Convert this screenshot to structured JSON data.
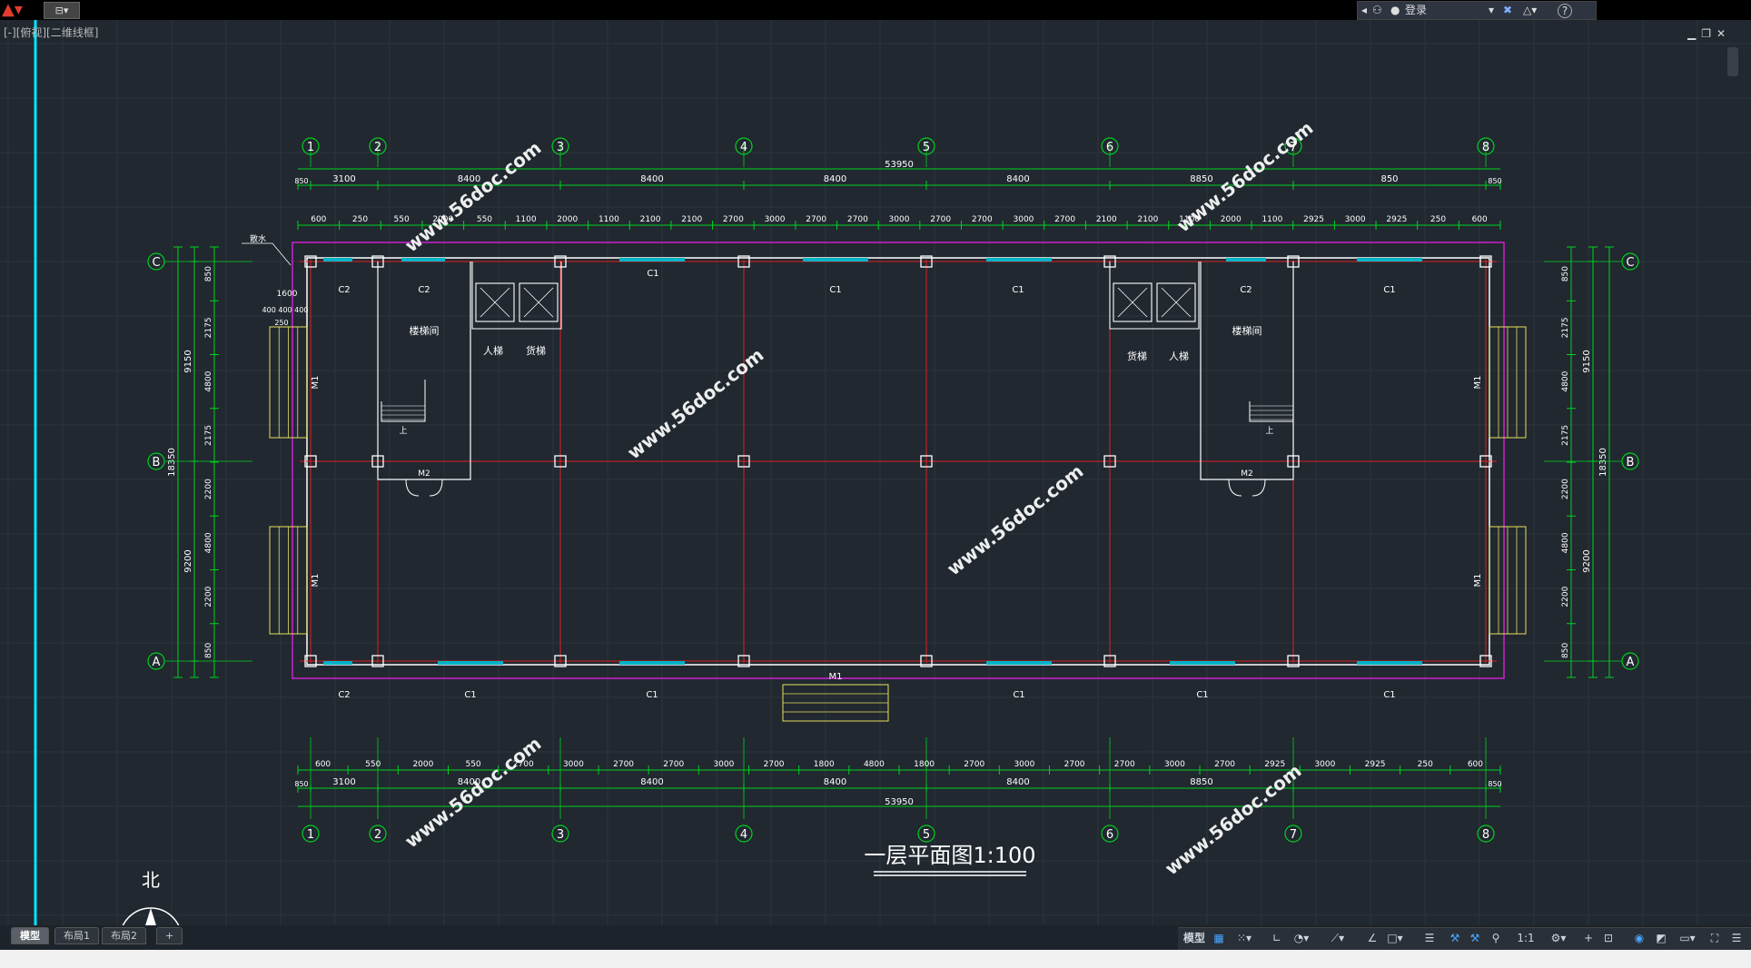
{
  "titlebar": {
    "app_icon": "autocad-a-icon",
    "qat_label": "⊟▾",
    "signin_label": "登录",
    "exchange_icon": "exchange-x-icon",
    "help_label": "?"
  },
  "viewport": {
    "label": "[-][俯视][二维线框]"
  },
  "drawing": {
    "title": "一层平面图1:100",
    "north_label": "北",
    "grid_cols": [
      "1",
      "2",
      "3",
      "4",
      "5",
      "6",
      "7",
      "8"
    ],
    "grid_rows": [
      "C",
      "B",
      "A"
    ],
    "total_length": "53950",
    "top_dims": [
      "850",
      "3100",
      "8400",
      "8400",
      "8400",
      "8400",
      "8850",
      "850"
    ],
    "top_fine_dims": [
      "600",
      "250",
      "550",
      "2000",
      "550",
      "1100",
      "2000",
      "1100",
      "2100",
      "2100",
      "2700",
      "3000",
      "2700",
      "2700",
      "3000",
      "2700",
      "2700",
      "3000",
      "2700",
      "2100",
      "2100",
      "1100",
      "2000",
      "1100",
      "2925",
      "3000",
      "2925",
      "250",
      "600"
    ],
    "bottom_fine_dims": [
      "600",
      "550",
      "2000",
      "550",
      "2700",
      "3000",
      "2700",
      "2700",
      "3000",
      "2700",
      "1800",
      "4800",
      "1800",
      "2700",
      "3000",
      "2700",
      "2700",
      "3000",
      "2700",
      "2925",
      "3000",
      "2925",
      "250",
      "600"
    ],
    "bottom_dims": [
      "850",
      "3100",
      "8400",
      "8400",
      "8400",
      "8400",
      "8850",
      "850"
    ],
    "side_total": "18350",
    "side_dims": [
      "9150",
      "9200"
    ],
    "side_fine_dims": [
      "850",
      "2175",
      "4800",
      "2175",
      "2200",
      "4800",
      "2200",
      "850"
    ],
    "left_extra": [
      "1600",
      "400",
      "400",
      "400",
      "250"
    ],
    "annotation": "散水",
    "windows": {
      "c1": "C1",
      "c2": "C2"
    },
    "doors": {
      "m1": "M1",
      "m2": "M2"
    },
    "rooms": {
      "stair": "楼梯间",
      "passenger_lift": "人梯",
      "freight_lift": "货梯",
      "up": "上"
    },
    "watermark": "www.56doc.com"
  },
  "tabs": [
    {
      "label": "模型",
      "active": true
    },
    {
      "label": "布局1",
      "active": false
    },
    {
      "label": "布局2",
      "active": false
    },
    {
      "label": "+",
      "active": false
    }
  ],
  "statusbar": {
    "model_label": "模型",
    "grid_icon": "grid-icon",
    "snap_icon": "snap-dots-icon",
    "ortho_icon": "ortho-icon",
    "polar_icon": "polar-icon",
    "osnap_icon": "osnap-icon",
    "lineweight_icon": "lineweight-icon",
    "scale_label": "1:1",
    "settings_icon": "gear-icon",
    "plus_icon": "plus-icon",
    "menu_icon": "hamburger-icon"
  },
  "colors": {
    "background": "#212830",
    "grid_line": "#e02020",
    "dimension": "#00d21e",
    "wall": "#ffffff",
    "outline": "#d020d0",
    "window": "#00b4c8",
    "step": "#e6e05a",
    "axis": "#00e6ff"
  }
}
